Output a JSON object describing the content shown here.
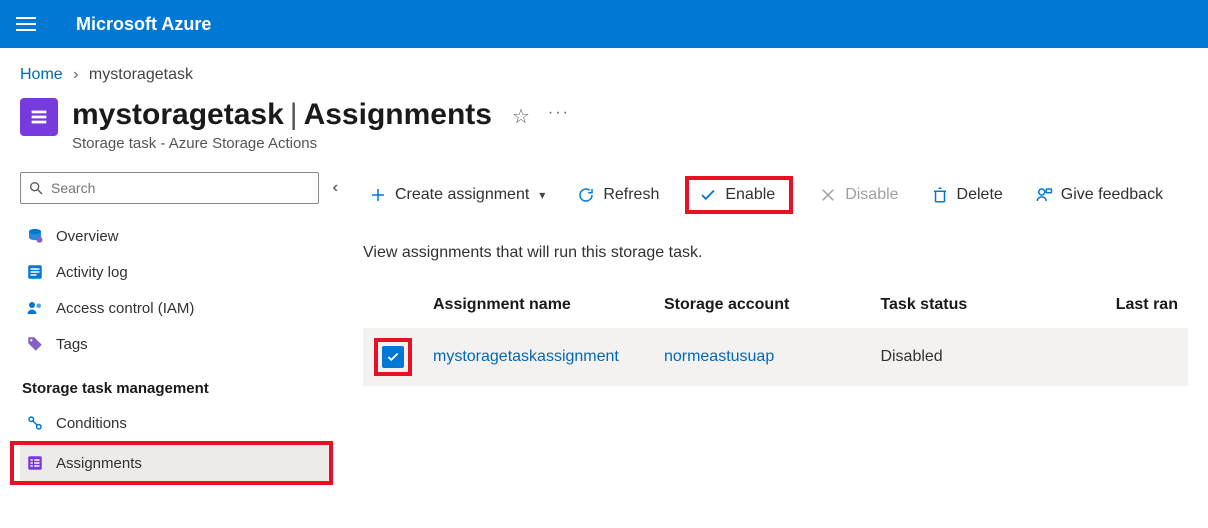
{
  "brand": "Microsoft Azure",
  "breadcrumb": {
    "home": "Home",
    "current": "mystoragetask"
  },
  "header": {
    "resource_name": "mystoragetask",
    "page_title": "Assignments",
    "subtitle": "Storage task - Azure Storage Actions"
  },
  "search": {
    "placeholder": "Search"
  },
  "nav": {
    "overview": "Overview",
    "activity_log": "Activity log",
    "access_control": "Access control (IAM)",
    "tags": "Tags",
    "section_storage_task": "Storage task management",
    "conditions": "Conditions",
    "assignments": "Assignments"
  },
  "toolbar": {
    "create": "Create assignment",
    "refresh": "Refresh",
    "enable": "Enable",
    "disable": "Disable",
    "delete": "Delete",
    "feedback": "Give feedback"
  },
  "main": {
    "description": "View assignments that will run this storage task."
  },
  "table": {
    "columns": {
      "name": "Assignment name",
      "account": "Storage account",
      "status": "Task status",
      "last_ran": "Last ran"
    },
    "rows": [
      {
        "checked": true,
        "name": "mystoragetaskassignment",
        "account": "normeastusuap",
        "status": "Disabled",
        "last_ran": ""
      }
    ]
  }
}
